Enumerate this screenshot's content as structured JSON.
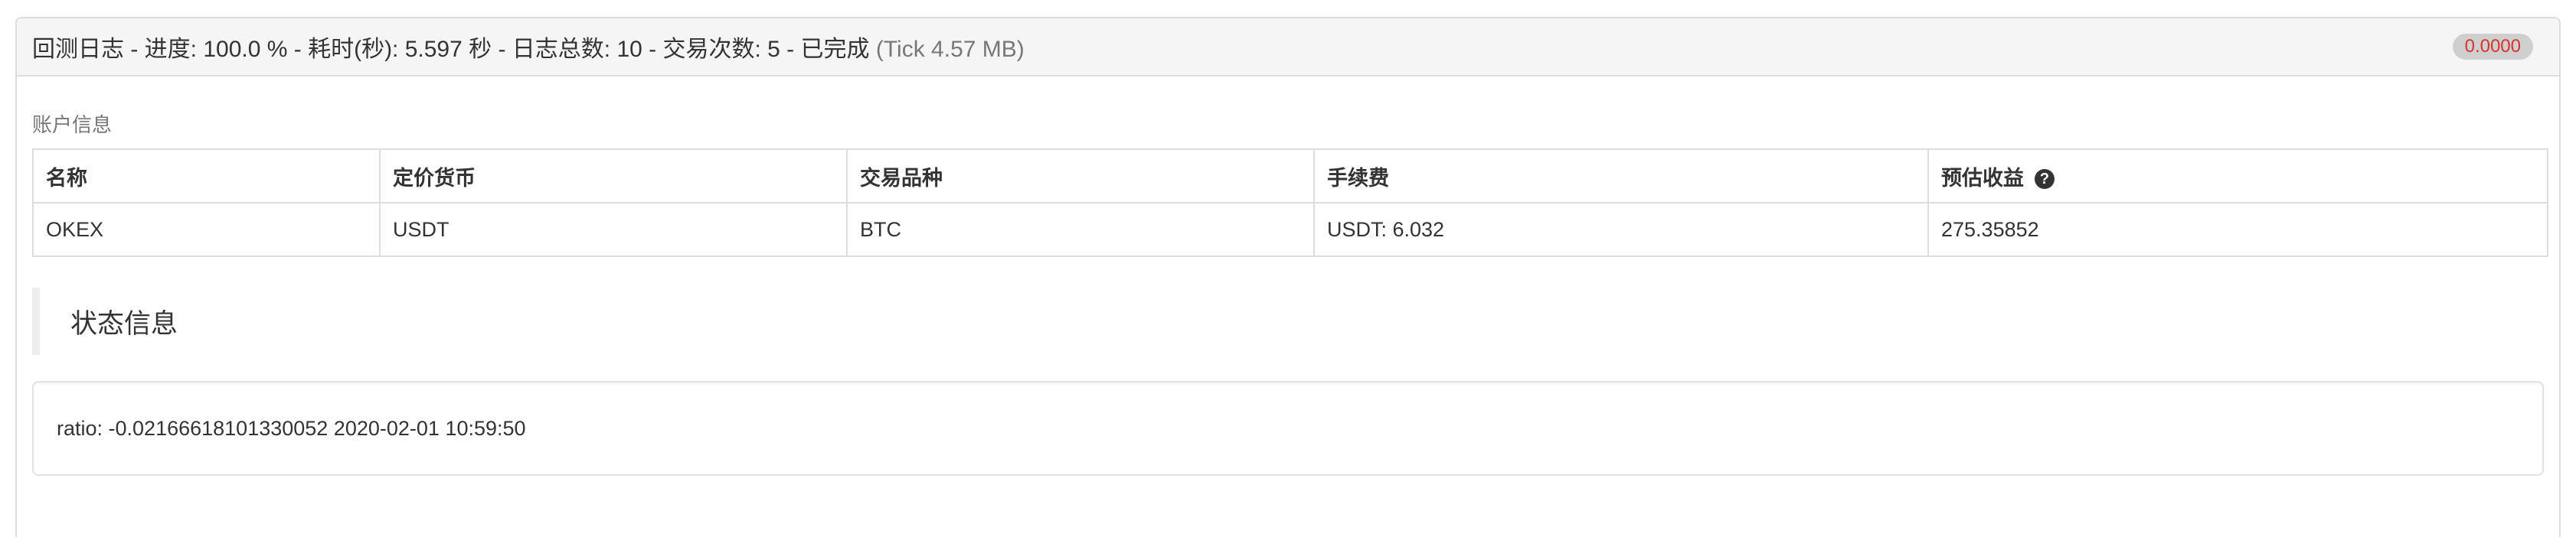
{
  "header": {
    "title_main": "回测日志 - 进度: 100.0 % - 耗时(秒): 5.597 秒 - 日志总数: 10 - 交易次数: 5 - 已完成",
    "title_muted": "(Tick 4.57 MB)",
    "badge": "0.0000",
    "badge_color": "#d9342b"
  },
  "account": {
    "label": "账户信息",
    "columns": [
      "名称",
      "定价货币",
      "交易品种",
      "手续费",
      "预估收益"
    ],
    "row": [
      "OKEX",
      "USDT",
      "BTC",
      "USDT: 6.032",
      "275.35852"
    ],
    "help_icon": "question-circle-icon"
  },
  "status": {
    "title": "状态信息",
    "content": "ratio: -0.02166618101330052 2020-02-01 10:59:50"
  }
}
